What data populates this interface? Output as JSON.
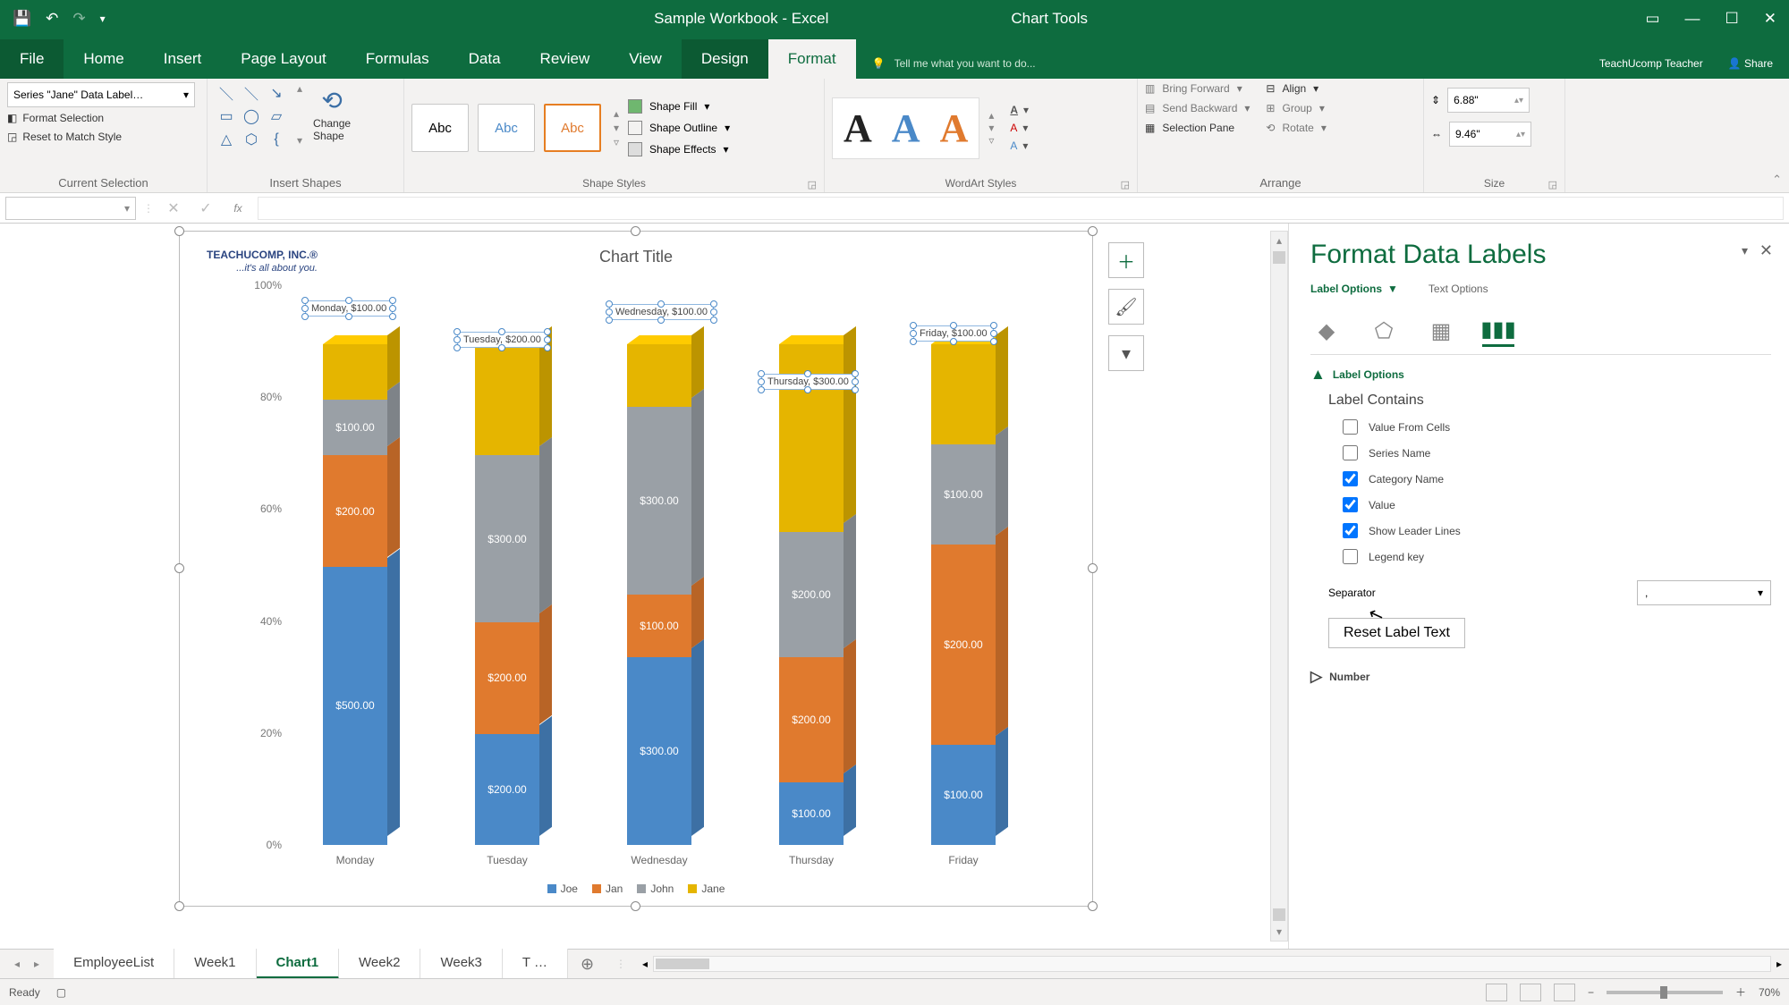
{
  "title_bar": {
    "doc_title": "Sample Workbook - Excel",
    "context_tab": "Chart Tools"
  },
  "menu": {
    "file": "File",
    "home": "Home",
    "insert": "Insert",
    "page_layout": "Page Layout",
    "formulas": "Formulas",
    "data": "Data",
    "review": "Review",
    "view": "View",
    "design": "Design",
    "format": "Format",
    "tell_me": "Tell me what you want to do...",
    "user": "TeachUcomp Teacher",
    "share": "Share"
  },
  "ribbon": {
    "current_selection": {
      "label": "Current Selection",
      "dropdown": "Series \"Jane\" Data Label…",
      "format_selection": "Format Selection",
      "reset_match": "Reset to Match Style"
    },
    "insert_shapes": {
      "label": "Insert Shapes",
      "change_shape": "Change\nShape"
    },
    "shape_styles": {
      "label": "Shape Styles",
      "abc": "Abc",
      "fill": "Shape Fill",
      "outline": "Shape Outline",
      "effects": "Shape Effects"
    },
    "wordart": {
      "label": "WordArt Styles"
    },
    "arrange": {
      "label": "Arrange",
      "bring_forward": "Bring Forward",
      "send_backward": "Send Backward",
      "selection_pane": "Selection Pane",
      "align": "Align",
      "group": "Group",
      "rotate": "Rotate"
    },
    "size": {
      "label": "Size",
      "height": "6.88\"",
      "width": "9.46\""
    }
  },
  "formula_bar": {
    "fx": "fx"
  },
  "chart_data": {
    "type": "bar_stacked_100",
    "title": "Chart Title",
    "logo": "TEACHUCOMP, INC.®",
    "logo_sub": "...it's all about you.",
    "categories": [
      "Monday",
      "Tuesday",
      "Wednesday",
      "Thursday",
      "Friday"
    ],
    "series": [
      {
        "name": "Joe",
        "color": "#4a89c8",
        "values": [
          500,
          200,
          300,
          100,
          100
        ]
      },
      {
        "name": "Jan",
        "color": "#e07a2e",
        "values": [
          200,
          200,
          100,
          200,
          200
        ]
      },
      {
        "name": "John",
        "color": "#9aa0a6",
        "values": [
          100,
          300,
          300,
          200,
          100
        ]
      },
      {
        "name": "Jane",
        "color": "#e5b500",
        "values": [
          100,
          200,
          100,
          300,
          100
        ]
      }
    ],
    "y_ticks": [
      "0%",
      "20%",
      "40%",
      "60%",
      "80%",
      "100%"
    ],
    "seg_labels": {
      "monday": [
        "$500.00",
        "$200.00",
        "$100.00",
        ""
      ],
      "tuesday": [
        "$200.00",
        "$200.00",
        "$300.00",
        ""
      ],
      "wednesday": [
        "$300.00",
        "$100.00",
        "$300.00",
        ""
      ],
      "thursday": [
        "$100.00",
        "$200.00",
        "$200.00",
        ""
      ],
      "friday": [
        "$100.00",
        "$200.00",
        "$100.00",
        ""
      ]
    },
    "data_labels_selected": [
      "Monday, $100.00",
      "Tuesday, $200.00",
      "Wednesday, $100.00",
      "Thursday, $300.00",
      "Friday, $100.00"
    ]
  },
  "format_pane": {
    "title": "Format Data Labels",
    "sub_label": "Label Options",
    "sub_text": "Text Options",
    "section": "Label Options",
    "label_contains": "Label Contains",
    "checks": {
      "value_from_cells": "Value From Cells",
      "series_name": "Series Name",
      "category_name": "Category Name",
      "value": "Value",
      "leader_lines": "Show Leader Lines",
      "legend_key": "Legend key"
    },
    "separator_label": "Separator",
    "separator_value": ",",
    "reset_btn": "Reset Label Text",
    "number": "Number"
  },
  "sheet_tabs": {
    "tabs": [
      "EmployeeList",
      "Week1",
      "Chart1",
      "Week2",
      "Week3",
      "T …"
    ],
    "active": "Chart1"
  },
  "status_bar": {
    "ready": "Ready",
    "zoom": "70%"
  }
}
